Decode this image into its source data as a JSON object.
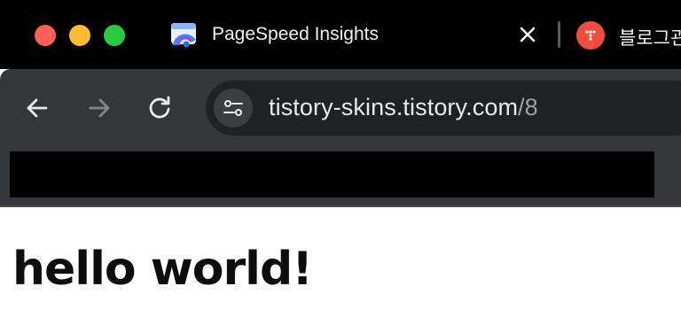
{
  "window": {
    "controls": {
      "close": "close-window",
      "minimize": "minimize-window",
      "maximize": "maximize-window"
    }
  },
  "tabs": [
    {
      "title": "PageSpeed Insights",
      "icon": "pagespeed-insights-icon",
      "active": true,
      "close_icon": "close-icon"
    },
    {
      "title": "블로그관",
      "icon": "blog-favicon",
      "active": false
    }
  ],
  "toolbar": {
    "back_icon": "back-arrow-icon",
    "forward_icon": "forward-arrow-icon",
    "forward_enabled": false,
    "reload_icon": "reload-icon",
    "site_info_icon": "site-settings-icon",
    "url_host": "tistory-skins.tistory.com",
    "url_path": "/8"
  },
  "page": {
    "heading": "hello world!"
  },
  "colors": {
    "tab_strip": "#000000",
    "toolbar": "#35363a",
    "omnibox": "#202124",
    "url_text": "#e8eaed",
    "url_path_text": "#9aa0a6",
    "close_red": "#fe5f57",
    "minimize_yellow": "#febc2e",
    "maximize_green": "#28c840",
    "blog_favicon": "#f24b3f",
    "page_background": "#ffffff"
  }
}
